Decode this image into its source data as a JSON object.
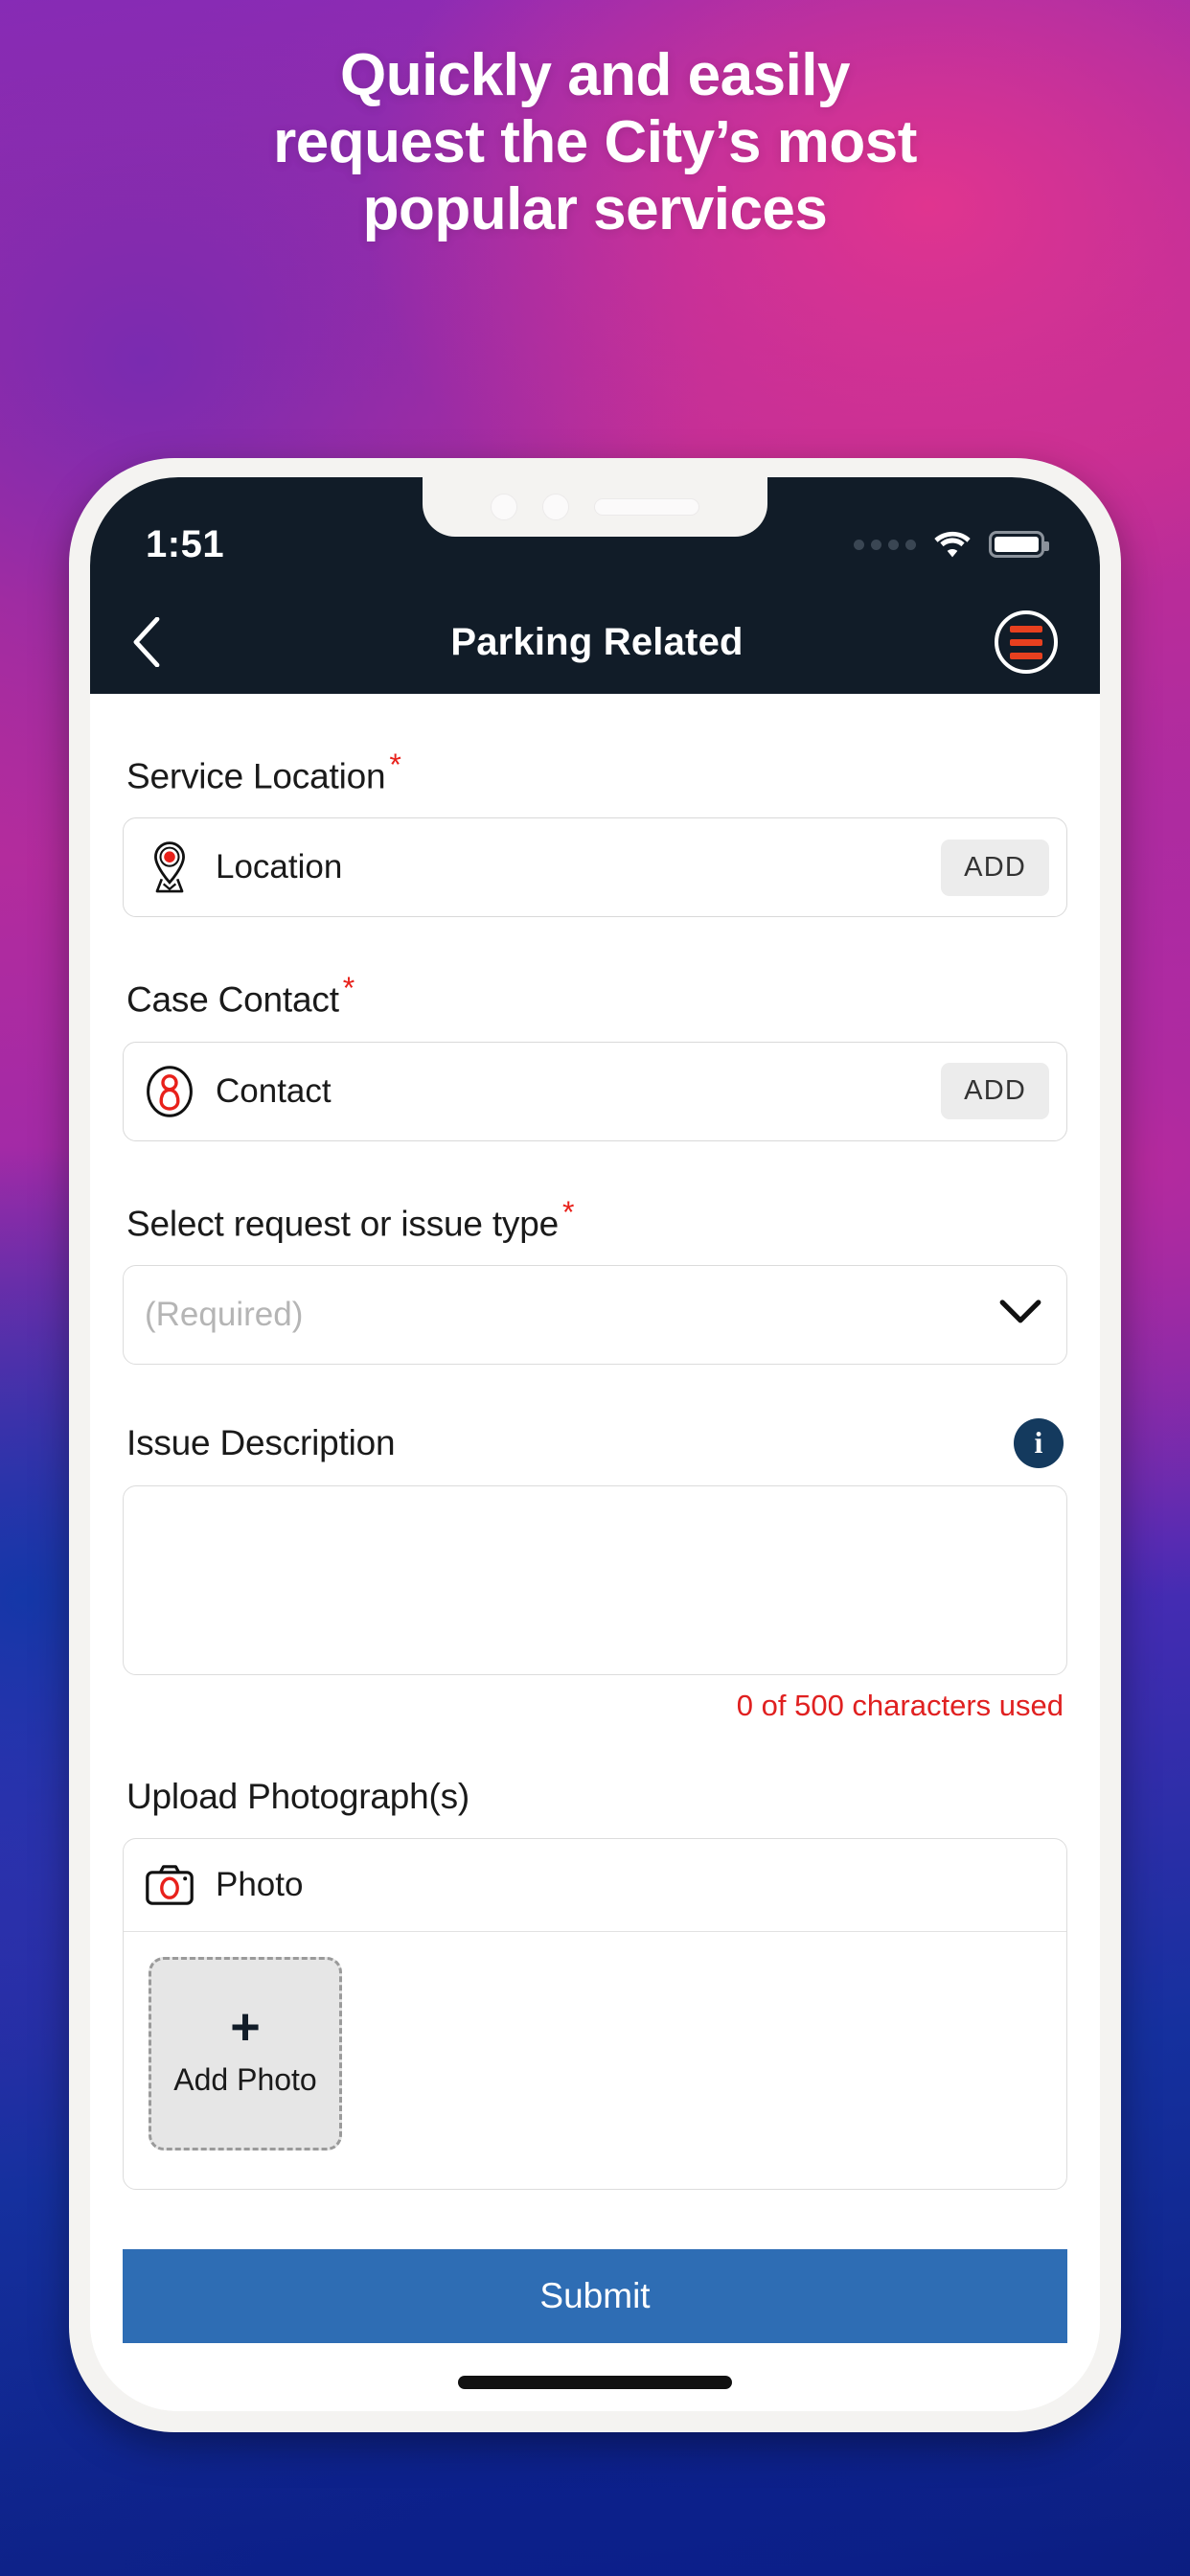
{
  "promo": {
    "headline_lines": [
      "Quickly and easily",
      "request the City’s most",
      "popular services"
    ]
  },
  "phone": {
    "statusbar": {
      "time": "1:51",
      "signal_icon": "signal-dots-icon",
      "wifi_icon": "wifi-icon",
      "battery_icon": "battery-full-icon"
    },
    "navbar": {
      "back_icon": "chevron-left-icon",
      "title": "Parking Related",
      "menu_icon": "hamburger-menu-icon"
    },
    "form": {
      "service_location": {
        "label": "Service Location",
        "required_marker": "*",
        "icon": "map-pin-icon",
        "value": "Location",
        "add_label": "ADD"
      },
      "case_contact": {
        "label": "Case Contact",
        "required_marker": "*",
        "icon": "contact-person-icon",
        "value": "Contact",
        "add_label": "ADD"
      },
      "request_type": {
        "label": "Select request or issue type",
        "required_marker": "*",
        "placeholder": "(Required)",
        "chevron_icon": "chevron-down-icon"
      },
      "issue_description": {
        "label": "Issue Description",
        "info_icon": "info-icon",
        "info_glyph": "i",
        "value": "",
        "char_counter": "0 of 500 characters used"
      },
      "upload_photographs": {
        "label": "Upload Photograph(s)",
        "row_icon": "camera-icon",
        "row_label": "Photo",
        "add_photo_plus": "+",
        "add_photo_label": "Add Photo"
      },
      "submit_label": "Submit"
    }
  },
  "colors": {
    "accent_red": "#e8401f",
    "required_red": "#e8211b",
    "counter_red": "#e02020",
    "submit_blue": "#2e6db4",
    "info_navy": "#143a5e",
    "navbar_dark": "#111c28"
  }
}
